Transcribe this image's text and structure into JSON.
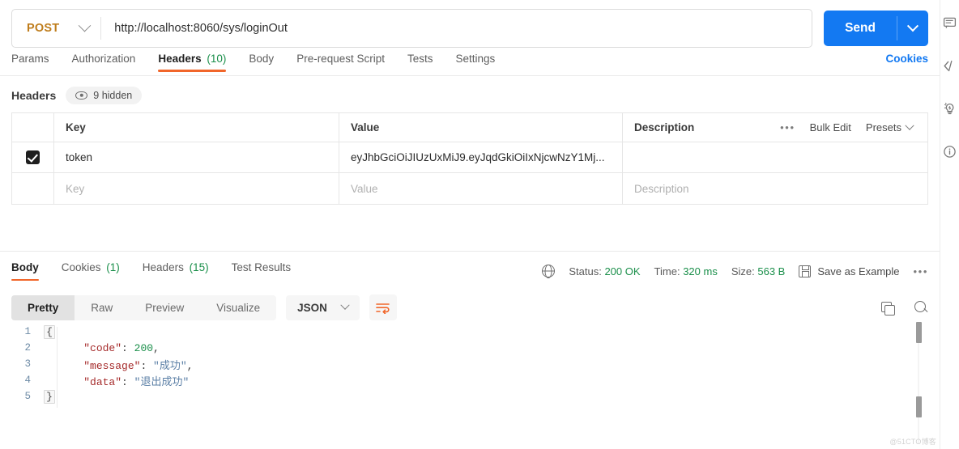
{
  "request": {
    "method": "POST",
    "url": "http://localhost:8060/sys/loginOut",
    "send_label": "Send",
    "tabs": [
      {
        "label": "Params",
        "count": "",
        "active": false
      },
      {
        "label": "Authorization",
        "count": "",
        "active": false
      },
      {
        "label": "Headers",
        "count": "(10)",
        "active": true
      },
      {
        "label": "Body",
        "count": "",
        "active": false
      },
      {
        "label": "Pre-request Script",
        "count": "",
        "active": false
      },
      {
        "label": "Tests",
        "count": "",
        "active": false
      },
      {
        "label": "Settings",
        "count": "",
        "active": false
      }
    ],
    "cookies_link": "Cookies"
  },
  "headers_section": {
    "title": "Headers",
    "hidden_pill": "9 hidden",
    "eye_icon": "eye-icon",
    "columns": {
      "key": "Key",
      "value": "Value",
      "description": "Description"
    },
    "actions": {
      "dots": "•••",
      "bulk_edit": "Bulk Edit",
      "presets": "Presets"
    },
    "rows": [
      {
        "checked": true,
        "key": "token",
        "value": "eyJhbGciOiJIUzUxMiJ9.eyJqdGkiOiIxNjcwNzY1Mj...",
        "description": ""
      }
    ],
    "empty_row": {
      "key": "Key",
      "value": "Value",
      "description": "Description"
    }
  },
  "response": {
    "tabs": [
      {
        "label": "Body",
        "count": "",
        "active": true
      },
      {
        "label": "Cookies",
        "count": "(1)",
        "active": false
      },
      {
        "label": "Headers",
        "count": "(15)",
        "active": false
      },
      {
        "label": "Test Results",
        "count": "",
        "active": false
      }
    ],
    "meta": {
      "globe_icon": "globe-icon",
      "status_label": "Status:",
      "status_value": "200 OK",
      "time_label": "Time:",
      "time_value": "320 ms",
      "size_label": "Size:",
      "size_value": "563 B",
      "save_icon": "save-disk-icon",
      "save_label": "Save as Example",
      "more": "•••"
    },
    "format_tabs": [
      {
        "label": "Pretty",
        "active": true
      },
      {
        "label": "Raw",
        "active": false
      },
      {
        "label": "Preview",
        "active": false
      },
      {
        "label": "Visualize",
        "active": false
      }
    ],
    "language": "JSON",
    "wrap_icon": "wrap-lines-icon",
    "copy_icon": "copy-icon",
    "search_icon": "search-icon",
    "body_lines": [
      {
        "num": "1",
        "fold": "{",
        "boxed": true,
        "tokens": []
      },
      {
        "num": "2",
        "fold": "",
        "boxed": false,
        "tokens": [
          {
            "t": "    ",
            "c": "k-pun"
          },
          {
            "t": "\"code\"",
            "c": "k-key"
          },
          {
            "t": ": ",
            "c": "k-pun"
          },
          {
            "t": "200",
            "c": "k-num"
          },
          {
            "t": ",",
            "c": "k-pun"
          }
        ]
      },
      {
        "num": "3",
        "fold": "",
        "boxed": false,
        "tokens": [
          {
            "t": "    ",
            "c": "k-pun"
          },
          {
            "t": "\"message\"",
            "c": "k-key"
          },
          {
            "t": ": ",
            "c": "k-pun"
          },
          {
            "t": "\"成功\"",
            "c": "k-str"
          },
          {
            "t": ",",
            "c": "k-pun"
          }
        ]
      },
      {
        "num": "4",
        "fold": "",
        "boxed": false,
        "tokens": [
          {
            "t": "    ",
            "c": "k-pun"
          },
          {
            "t": "\"data\"",
            "c": "k-key"
          },
          {
            "t": ": ",
            "c": "k-pun"
          },
          {
            "t": "\"退出成功\"",
            "c": "k-str"
          }
        ]
      },
      {
        "num": "5",
        "fold": "}",
        "boxed": true,
        "tokens": []
      }
    ]
  },
  "rail": {
    "icons": [
      "comment-icon",
      "code-icon",
      "lightbulb-icon",
      "info-icon"
    ]
  },
  "watermark": "@51CTO博客",
  "colors": {
    "accent_blue": "#1379f2",
    "accent_orange": "#f1662a",
    "method_amber": "#bf7d1c",
    "status_green": "#1a8f4a"
  }
}
